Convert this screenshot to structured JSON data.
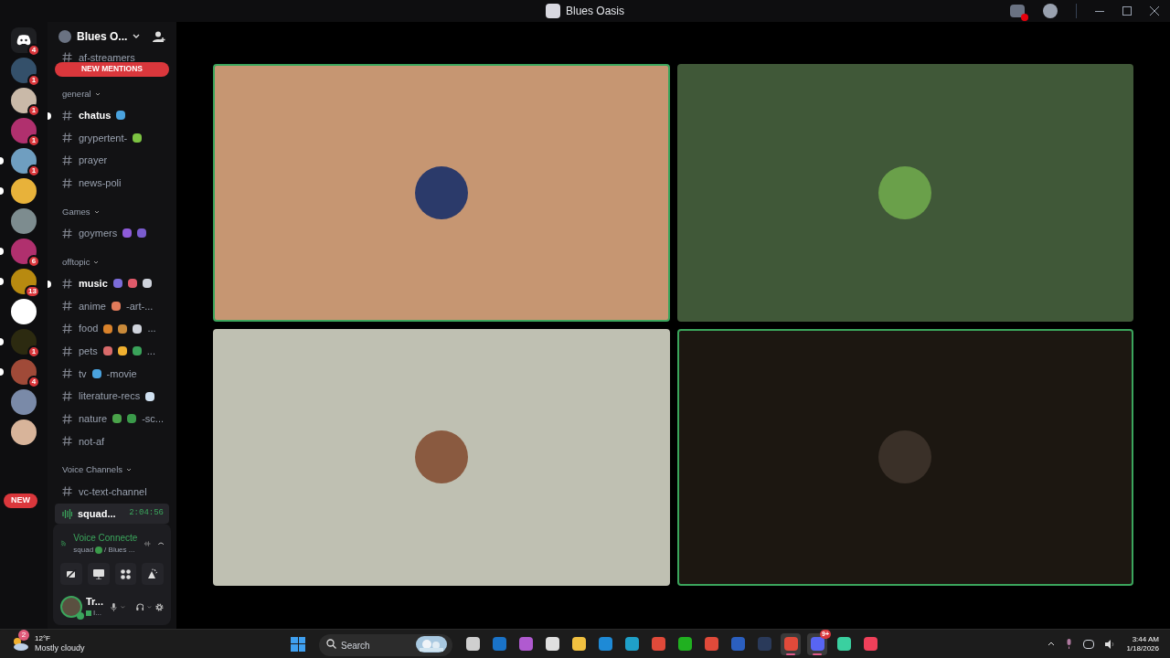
{
  "window": {
    "title": "Blues Oasis"
  },
  "servers": [
    {
      "kind": "home",
      "badge": "4",
      "unread": false
    },
    {
      "kind": "avatar",
      "badge": "1",
      "unread": false,
      "color": "#34506a"
    },
    {
      "kind": "avatar",
      "badge": "1",
      "unread": false,
      "color": "#c9b9a8"
    },
    {
      "kind": "avatar",
      "badge": "1",
      "unread": false,
      "color": "#b0306e"
    },
    {
      "kind": "avatar",
      "badge": "1",
      "unread": true,
      "color": "#6f9ec0"
    },
    {
      "kind": "avatar",
      "unread": true,
      "color": "#e8b23a"
    },
    {
      "kind": "avatar",
      "unread": false,
      "color": "#7d8c8f"
    },
    {
      "kind": "avatar",
      "badge": "6",
      "unread": true,
      "color": "#b0306e"
    },
    {
      "kind": "avatar",
      "badge": "13",
      "unread": true,
      "color": "#b88a10"
    },
    {
      "kind": "avatar",
      "unread": false,
      "color": "#ffffff"
    },
    {
      "kind": "avatar",
      "badge": "1",
      "unread": true,
      "color": "#2c2a10"
    },
    {
      "kind": "avatar",
      "badge": "4",
      "unread": true,
      "color": "#a04a38"
    },
    {
      "kind": "avatar",
      "unread": false,
      "color": "#7a8aa8"
    },
    {
      "kind": "avatar",
      "unread": false,
      "color": "#d8b49a"
    }
  ],
  "new_pill": "NEW",
  "server_name": "Blues O...",
  "new_mentions": "NEW MENTIONS",
  "channel_groups": [
    {
      "channels": [
        {
          "name": "af-streamers",
          "unread": false
        }
      ]
    },
    {
      "name": "general",
      "channels": [
        {
          "name": "chatus",
          "unread": true,
          "emojis": [
            {
              "color": "#4aa3df"
            }
          ]
        },
        {
          "name": "grypertent-",
          "unread": false,
          "emojis": [
            {
              "color": "#7cc242"
            }
          ]
        },
        {
          "name": "prayer",
          "unread": false
        },
        {
          "name": "news-poli",
          "unread": false
        }
      ]
    },
    {
      "name": "Games",
      "channels": [
        {
          "name": "goymers",
          "unread": false,
          "emojis": [
            {
              "color": "#8e5bd9"
            },
            {
              "color": "#7a5ccf"
            }
          ]
        }
      ]
    },
    {
      "name": "offtopic",
      "channels": [
        {
          "name": "music",
          "unread": true,
          "emojis": [
            {
              "color": "#7b6cd9"
            },
            {
              "color": "#e05a6a"
            },
            {
              "color": "#cfd3dc"
            }
          ]
        },
        {
          "name": "anime",
          "unread": false,
          "emojis": [
            {
              "color": "#e07a5a"
            }
          ],
          "suffix": "-art-..."
        },
        {
          "name": "food",
          "unread": false,
          "emojis": [
            {
              "color": "#d9822b"
            },
            {
              "color": "#c98a3a"
            },
            {
              "color": "#cfd3dc"
            }
          ],
          "suffix": "..."
        },
        {
          "name": "pets",
          "unread": false,
          "emojis": [
            {
              "color": "#d86a6a"
            },
            {
              "color": "#f0b030"
            },
            {
              "color": "#3aa35a"
            }
          ],
          "suffix": "..."
        },
        {
          "name": "tv",
          "unread": false,
          "emojis": [
            {
              "color": "#4aa3df"
            }
          ],
          "suffix": "-movie"
        },
        {
          "name": "literature-recs",
          "unread": false,
          "emojis": [
            {
              "color": "#cfe0f0"
            }
          ]
        },
        {
          "name": "nature",
          "unread": false,
          "emojis": [
            {
              "color": "#4aa34a"
            },
            {
              "color": "#3a9a4a"
            }
          ],
          "suffix": "-sc..."
        },
        {
          "name": "not-af",
          "unread": false
        }
      ]
    },
    {
      "name": "Voice Channels",
      "channels": [
        {
          "name": "vc-text-channel",
          "unread": false
        }
      ]
    }
  ],
  "active_voice": {
    "name": "squad...",
    "timer": "2:04:56"
  },
  "voice_panel": {
    "status": "Voice Connecte",
    "channel": "squad",
    "server": "/ Blues ..."
  },
  "user": {
    "name": "Tr...",
    "activity": "I..."
  },
  "tiles": [
    {
      "color": "#c69672",
      "avatar": {
        "color": "#2b3a6a"
      },
      "speaking": true
    },
    {
      "color": "#405838",
      "avatar": {
        "color": "#6aa04a"
      },
      "speaking": false
    },
    {
      "color": "#bfc0b2",
      "avatar": {
        "color": "#8a5a40"
      },
      "speaking": false
    },
    {
      "color": "#1c1711",
      "avatar": {
        "color": "#3a3028"
      },
      "speaking": true
    }
  ],
  "taskbar": {
    "weather": {
      "badge": "2",
      "temp": "12°F",
      "desc": "Mostly cloudy"
    },
    "search": {
      "placeholder": "Search"
    },
    "apps": [
      {
        "color": "#cfcfcf",
        "active": false
      },
      {
        "color": "#1a73c8",
        "active": false
      },
      {
        "color": "#b05ad0",
        "active": false
      },
      {
        "color": "#e0e0e0",
        "active": false
      },
      {
        "color": "#f0c040",
        "active": false
      },
      {
        "color": "#1e8ad6",
        "active": false
      },
      {
        "color": "#1fa0c8",
        "active": false
      },
      {
        "color": "#e04a3a",
        "active": false
      },
      {
        "color": "#20b020",
        "active": false
      },
      {
        "color": "#e04a3a",
        "active": false
      },
      {
        "color": "#2b5fbf",
        "active": false
      },
      {
        "color": "#2a3a5a",
        "active": false
      },
      {
        "color": "#e04a3a",
        "active": true
      },
      {
        "color": "#5865f2",
        "active": true,
        "badge": "9+"
      },
      {
        "color": "#3ad0a0",
        "active": false
      },
      {
        "color": "#f0405a",
        "active": false
      }
    ],
    "time": "3:44 AM",
    "date": "1/18/2026"
  }
}
